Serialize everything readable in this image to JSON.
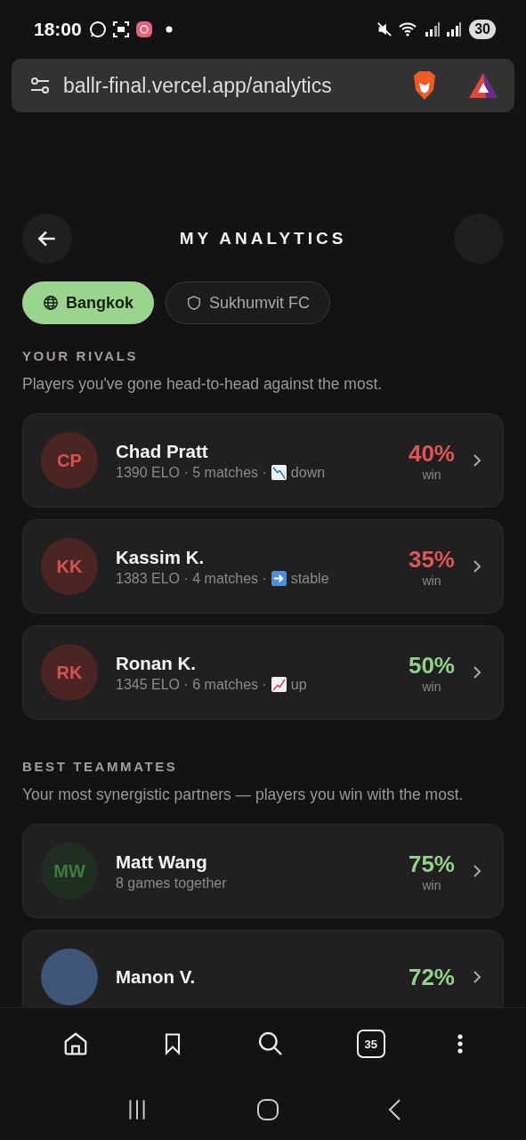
{
  "status_bar": {
    "time": "18:00",
    "battery": "30"
  },
  "browser": {
    "url": "ballr-final.vercel.app/analytics",
    "tab_count": "35"
  },
  "header": {
    "title": "MY ANALYTICS"
  },
  "chips": [
    {
      "label": "Bangkok",
      "kind": "globe",
      "selected": true
    },
    {
      "label": "Sukhumvit FC",
      "kind": "shield",
      "selected": false
    }
  ],
  "rivals": {
    "heading": "YOUR RIVALS",
    "description": "Players you've gone head-to-head against the most.",
    "items": [
      {
        "initials": "CP",
        "name": "Chad Pratt",
        "stats": "1390 ELO · 5 matches ·",
        "kind": "down",
        "trend_label": "down",
        "win": "40%",
        "win_label": "win",
        "good": false
      },
      {
        "initials": "KK",
        "name": "Kassim K.",
        "stats": "1383 ELO · 4 matches ·",
        "kind": "stable",
        "trend_label": "stable",
        "win": "35%",
        "win_label": "win",
        "good": false
      },
      {
        "initials": "RK",
        "name": "Ronan K.",
        "stats": "1345 ELO · 6 matches ·",
        "kind": "up",
        "trend_label": "up",
        "win": "50%",
        "win_label": "win",
        "good": true
      }
    ]
  },
  "teammates": {
    "heading": "BEST TEAMMATES",
    "description": "Your most synergistic partners — players you win with the most.",
    "items": [
      {
        "initials": "MW",
        "color": "#1f2e20",
        "name": "Matt Wang",
        "stats": "8 games together",
        "win": "75%",
        "win_label": "win"
      },
      {
        "color": "#3c5578",
        "name": "Manon V.",
        "win": "72%"
      }
    ]
  }
}
